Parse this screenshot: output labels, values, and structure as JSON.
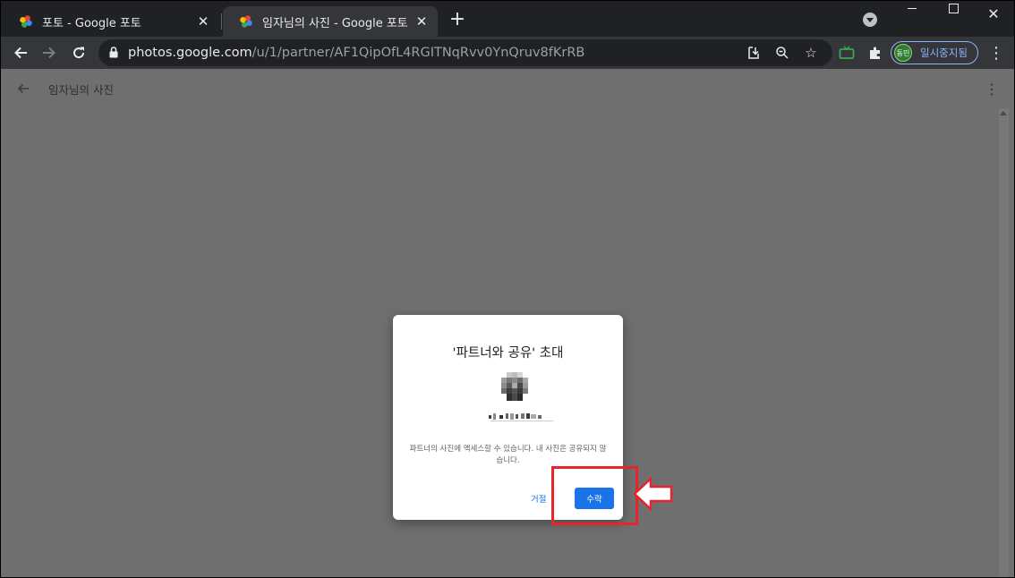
{
  "tabs": [
    {
      "title": "포토 - Google 포토",
      "active": false
    },
    {
      "title": "임자님의 사진 - Google 포토",
      "active": true
    }
  ],
  "toolbar": {
    "url_host": "photos.google.com",
    "url_path": "/u/1/partner/AF1QipOfL4RGITNqRvv0YnQruv8fKrRB",
    "profile_avatar_text": "동민",
    "profile_label": "일시중지됨"
  },
  "page": {
    "title": "임자님의 사진"
  },
  "dialog": {
    "title": "'파트너와 공유' 초대",
    "body": "파트너의 사진에 액세스할 수 있습니다. 내 사진은 공유되지 않습니다.",
    "reject_label": "거절",
    "accept_label": "수락"
  },
  "colors": {
    "accent": "#1a73e8",
    "highlight": "#e8232a",
    "overlay_bg": "#6f6f6f"
  },
  "icons": [
    "google-photos-icon",
    "close-icon",
    "plus-icon",
    "back-arrow-icon",
    "forward-arrow-icon",
    "reload-icon",
    "lock-icon",
    "install-icon",
    "zoom-icon",
    "star-icon",
    "tv-extension-icon",
    "puzzle-icon",
    "kebab-menu-icon"
  ]
}
